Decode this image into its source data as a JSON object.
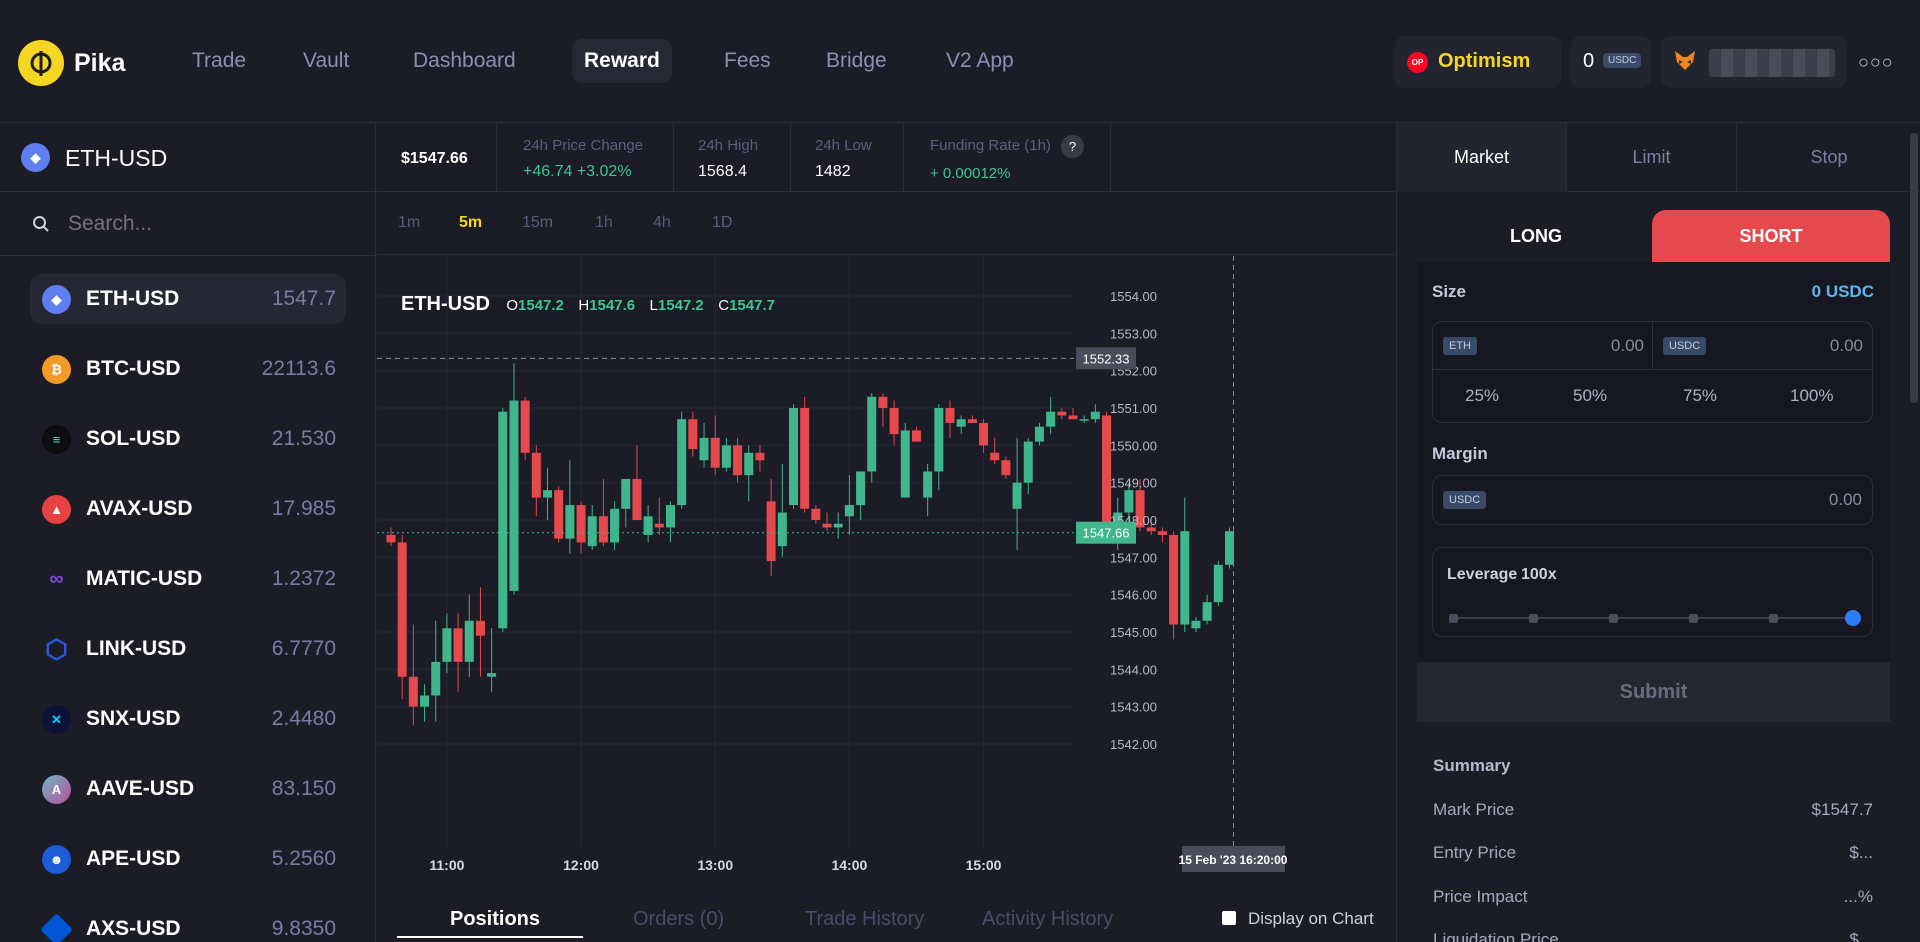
{
  "brand": {
    "name": "Pika"
  },
  "nav": [
    {
      "label": "Trade"
    },
    {
      "label": "Vault"
    },
    {
      "label": "Dashboard"
    },
    {
      "label": "Reward"
    },
    {
      "label": "Fees"
    },
    {
      "label": "Bridge"
    },
    {
      "label": "V2 App"
    }
  ],
  "network": {
    "badge": "OP",
    "label": "Optimism",
    "color": "#f5d623"
  },
  "balance": {
    "value": "0",
    "token": "USDC"
  },
  "market": {
    "symbol": "ETH-USD"
  },
  "search": {
    "placeholder": "Search..."
  },
  "markets": [
    {
      "symbol": "ETH-USD",
      "price": "1547.7",
      "icon": "eth-icon",
      "color": "#5f7ef0"
    },
    {
      "symbol": "BTC-USD",
      "price": "22113.6",
      "icon": "btc-icon",
      "color": "#f39b26"
    },
    {
      "symbol": "SOL-USD",
      "price": "21.530",
      "icon": "sol-icon",
      "color": "#0d0d12"
    },
    {
      "symbol": "AVAX-USD",
      "price": "17.985",
      "icon": "avax-icon",
      "color": "#e84142"
    },
    {
      "symbol": "MATIC-USD",
      "price": "1.2372",
      "icon": "matic-icon",
      "color": "#8247e5"
    },
    {
      "symbol": "LINK-USD",
      "price": "6.7770",
      "icon": "link-icon",
      "color": "#2a5ada"
    },
    {
      "symbol": "SNX-USD",
      "price": "2.4480",
      "icon": "snx-icon",
      "color": "#0b1239"
    },
    {
      "symbol": "AAVE-USD",
      "price": "83.150",
      "icon": "aave-icon",
      "color": "#6fb6c5"
    },
    {
      "symbol": "APE-USD",
      "price": "5.2560",
      "icon": "ape-icon",
      "color": "#1e5bd9"
    },
    {
      "symbol": "AXS-USD",
      "price": "9.8350",
      "icon": "axs-icon",
      "color": "#0055d5"
    }
  ],
  "stats": {
    "price": "$1547.66",
    "change_label": "24h Price Change",
    "change_value": "+46.74 +3.02%",
    "high_label": "24h High",
    "high_value": "1568.4",
    "low_label": "24h Low",
    "low_value": "1482",
    "funding_label": "Funding Rate (1h)",
    "funding_value": "+ 0.00012%",
    "help": "?"
  },
  "timeframes": [
    {
      "label": "1m"
    },
    {
      "label": "5m"
    },
    {
      "label": "15m"
    },
    {
      "label": "1h"
    },
    {
      "label": "4h"
    },
    {
      "label": "1D"
    }
  ],
  "selected_timeframe": "5m",
  "chart_data": {
    "type": "candlestick",
    "symbol": "ETH-USD",
    "ohlc_legend": {
      "o_label": "O",
      "o": "1547.2",
      "h_label": "H",
      "h": "1547.6",
      "l_label": "L",
      "l": "1547.2",
      "c_label": "C",
      "c": "1547.7"
    },
    "y_ticks": [
      "1554.00",
      "1553.00",
      "1552.00",
      "1551.00",
      "1550.00",
      "1549.00",
      "1548.00",
      "1547.00",
      "1546.00",
      "1545.00",
      "1544.00",
      "1543.00",
      "1542.00"
    ],
    "ylim": [
      1541.5,
      1554.5
    ],
    "x_ticks": [
      {
        "label": "11:00",
        "index": 5
      },
      {
        "label": "12:00",
        "index": 17
      },
      {
        "label": "13:00",
        "index": 29
      },
      {
        "label": "14:00",
        "index": 41
      },
      {
        "label": "15:00",
        "index": 53
      }
    ],
    "crosshair_price": "1552.33",
    "last_price": "1547.66",
    "crosshair_time": "15 Feb '23   16:20:00",
    "up_color": "#3fb68b",
    "down_color": "#e5484d",
    "candles": [
      [
        1547.6,
        1547.8,
        1547.3,
        1547.4
      ],
      [
        1547.4,
        1547.6,
        1543.2,
        1543.8
      ],
      [
        1543.8,
        1545.2,
        1542.5,
        1543.0
      ],
      [
        1543.0,
        1543.6,
        1542.6,
        1543.3
      ],
      [
        1543.3,
        1545.3,
        1542.6,
        1544.2
      ],
      [
        1544.2,
        1545.5,
        1543.9,
        1545.1
      ],
      [
        1545.1,
        1545.5,
        1543.4,
        1544.2
      ],
      [
        1544.2,
        1546.0,
        1543.8,
        1545.3
      ],
      [
        1545.3,
        1546.2,
        1543.8,
        1544.9
      ],
      [
        1543.8,
        1545.1,
        1543.4,
        1543.9
      ],
      [
        1545.1,
        1551.0,
        1545.0,
        1550.9
      ],
      [
        1546.1,
        1552.2,
        1546.0,
        1551.2
      ],
      [
        1551.2,
        1551.3,
        1549.6,
        1549.8
      ],
      [
        1549.8,
        1550.0,
        1548.1,
        1548.6
      ],
      [
        1548.6,
        1549.4,
        1548.0,
        1548.8
      ],
      [
        1548.8,
        1548.9,
        1547.4,
        1547.5
      ],
      [
        1547.5,
        1549.6,
        1547.1,
        1548.4
      ],
      [
        1548.4,
        1548.5,
        1547.1,
        1547.4
      ],
      [
        1547.3,
        1548.4,
        1547.2,
        1548.1
      ],
      [
        1548.1,
        1549.1,
        1547.3,
        1547.4
      ],
      [
        1547.4,
        1548.5,
        1547.2,
        1548.3
      ],
      [
        1548.3,
        1548.8,
        1547.8,
        1549.1
      ],
      [
        1549.1,
        1550.0,
        1548.0,
        1548.0
      ],
      [
        1547.6,
        1548.4,
        1547.4,
        1548.1
      ],
      [
        1547.9,
        1548.6,
        1547.6,
        1547.8
      ],
      [
        1547.8,
        1548.5,
        1547.4,
        1548.4
      ],
      [
        1548.4,
        1550.9,
        1548.3,
        1550.7
      ],
      [
        1550.7,
        1550.9,
        1549.7,
        1549.9
      ],
      [
        1549.6,
        1550.6,
        1549.4,
        1550.2
      ],
      [
        1550.2,
        1550.8,
        1549.2,
        1549.4
      ],
      [
        1549.4,
        1550.2,
        1549.3,
        1550.0
      ],
      [
        1550.0,
        1550.2,
        1549.0,
        1549.2
      ],
      [
        1549.2,
        1550.0,
        1548.5,
        1549.8
      ],
      [
        1549.8,
        1550.0,
        1549.3,
        1549.6
      ],
      [
        1548.5,
        1549.1,
        1546.5,
        1546.9
      ],
      [
        1547.3,
        1549.5,
        1547.0,
        1548.2
      ],
      [
        1548.4,
        1551.1,
        1548.3,
        1551.0
      ],
      [
        1551.0,
        1551.3,
        1548.2,
        1548.3
      ],
      [
        1548.3,
        1548.4,
        1547.9,
        1548.0
      ],
      [
        1547.9,
        1548.2,
        1547.7,
        1547.8
      ],
      [
        1547.8,
        1548.2,
        1547.5,
        1547.9
      ],
      [
        1548.1,
        1549.2,
        1547.6,
        1548.4
      ],
      [
        1548.4,
        1549.0,
        1548.0,
        1549.3
      ],
      [
        1549.3,
        1551.4,
        1549.0,
        1551.3
      ],
      [
        1551.3,
        1551.4,
        1550.5,
        1551.0
      ],
      [
        1551.0,
        1551.2,
        1550.0,
        1550.3
      ],
      [
        1548.6,
        1550.6,
        1548.6,
        1550.4
      ],
      [
        1550.4,
        1550.5,
        1550.1,
        1550.1
      ],
      [
        1548.6,
        1549.5,
        1548.1,
        1549.3
      ],
      [
        1549.3,
        1551.1,
        1548.8,
        1551.0
      ],
      [
        1551.0,
        1551.2,
        1550.2,
        1550.6
      ],
      [
        1550.5,
        1550.8,
        1550.3,
        1550.7
      ],
      [
        1550.7,
        1550.8,
        1550.6,
        1550.6
      ],
      [
        1550.6,
        1550.7,
        1549.8,
        1550.0
      ],
      [
        1549.8,
        1550.2,
        1549.5,
        1549.6
      ],
      [
        1549.6,
        1549.7,
        1549.1,
        1549.2
      ],
      [
        1548.3,
        1550.2,
        1547.2,
        1549.0
      ],
      [
        1549.0,
        1550.2,
        1548.7,
        1550.1
      ],
      [
        1550.1,
        1550.6,
        1550.0,
        1550.5
      ],
      [
        1550.5,
        1551.3,
        1550.3,
        1550.9
      ],
      [
        1550.9,
        1551.0,
        1550.7,
        1550.8
      ],
      [
        1550.8,
        1551.0,
        1550.7,
        1550.7
      ],
      [
        1550.7,
        1550.8,
        1550.6,
        1550.7
      ],
      [
        1550.7,
        1551.1,
        1550.6,
        1550.9
      ],
      [
        1550.8,
        1550.9,
        1547.6,
        1547.6
      ],
      [
        1547.6,
        1548.6,
        1547.2,
        1548.2
      ],
      [
        1548.2,
        1549.0,
        1547.6,
        1548.8
      ],
      [
        1548.8,
        1549.1,
        1547.7,
        1547.8
      ],
      [
        1547.8,
        1547.9,
        1547.6,
        1547.7
      ],
      [
        1547.7,
        1547.8,
        1547.4,
        1547.6
      ],
      [
        1547.6,
        1547.7,
        1544.8,
        1545.2
      ],
      [
        1545.2,
        1548.6,
        1545.0,
        1547.7
      ],
      [
        1545.1,
        1545.4,
        1545.0,
        1545.3
      ],
      [
        1545.3,
        1546.0,
        1545.2,
        1545.8
      ],
      [
        1545.8,
        1546.9,
        1545.7,
        1546.8
      ],
      [
        1546.8,
        1547.8,
        1546.7,
        1547.7
      ]
    ]
  },
  "bottom_tabs": [
    {
      "label": "Positions"
    },
    {
      "label": "Orders (0)"
    },
    {
      "label": "Trade History"
    },
    {
      "label": "Activity History"
    }
  ],
  "display_on_chart": "Display on Chart",
  "order": {
    "types": [
      {
        "label": "Market"
      },
      {
        "label": "Limit"
      },
      {
        "label": "Stop"
      }
    ],
    "long_label": "LONG",
    "short_label": "SHORT",
    "size_label": "Size",
    "size_value": "0 USDC",
    "eth_token": "ETH",
    "eth_amount": "0.00",
    "usdc_token": "USDC",
    "usdc_amount": "0.00",
    "percents": [
      {
        "label": "25%"
      },
      {
        "label": "50%"
      },
      {
        "label": "75%"
      },
      {
        "label": "100%"
      }
    ],
    "margin_label": "Margin",
    "margin_token": "USDC",
    "margin_amount": "0.00",
    "leverage_label": "Leverage",
    "leverage_value": "100x",
    "leverage_level": 1.0,
    "submit_label": "Submit",
    "short_color": "#e5484d"
  },
  "summary": {
    "title": "Summary",
    "rows": [
      {
        "label": "Mark Price",
        "value": "$1547.7"
      },
      {
        "label": "Entry Price",
        "value": "$..."
      },
      {
        "label": "Price Impact",
        "value": "...%"
      },
      {
        "label": "Liquidation Price",
        "value": "$..."
      }
    ]
  }
}
